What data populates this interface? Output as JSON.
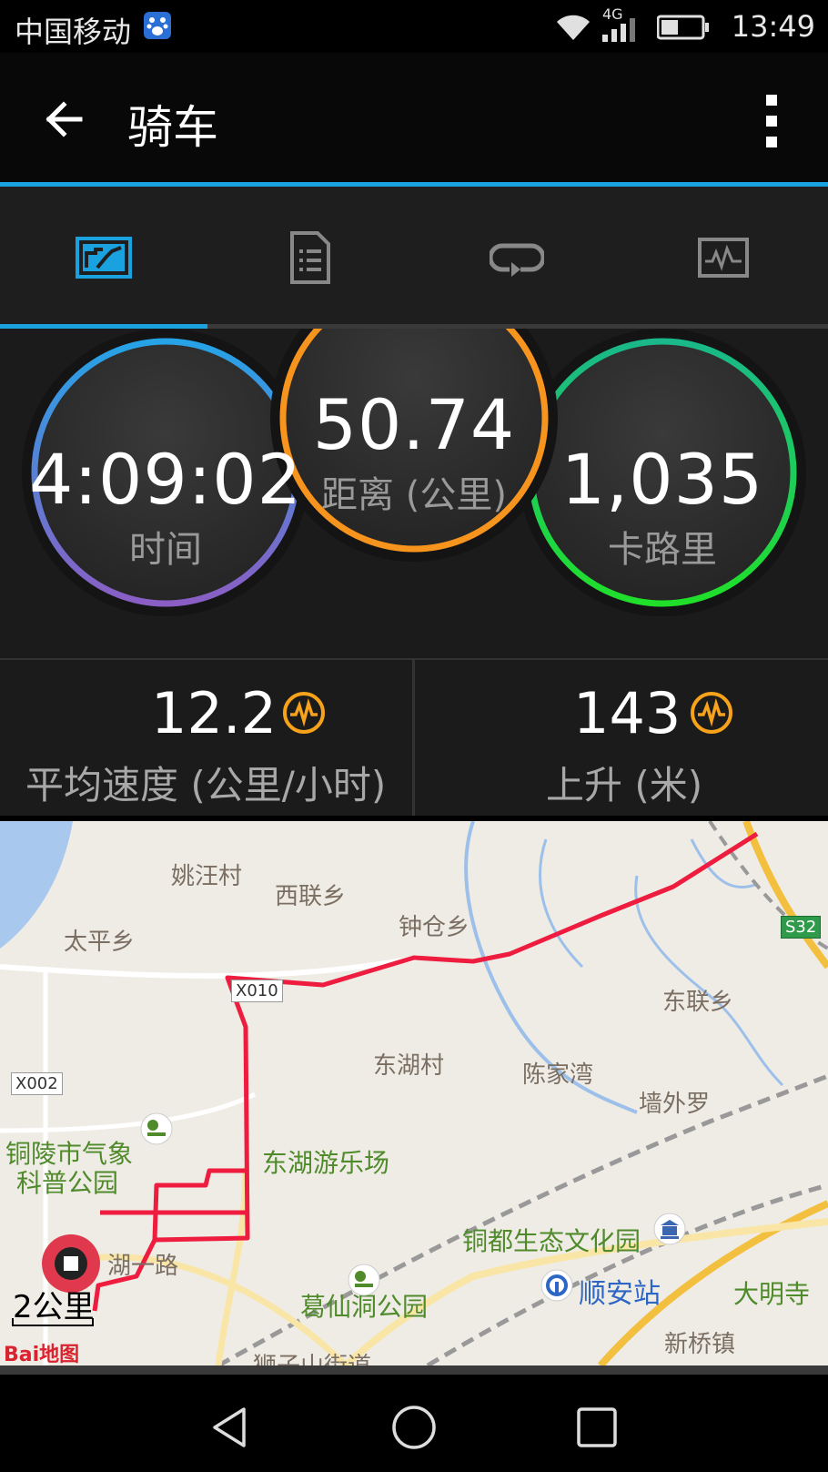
{
  "status_bar": {
    "carrier": "中国移动",
    "network": "4G",
    "time": "13:49"
  },
  "app_bar": {
    "title": "骑车",
    "back_icon": "arrow-back-icon",
    "more_icon": "more-vertical-icon"
  },
  "tabs": [
    {
      "icon": "stats-dashboard-icon",
      "active": true
    },
    {
      "icon": "document-list-icon",
      "active": false
    },
    {
      "icon": "loop-repeat-icon",
      "active": false
    },
    {
      "icon": "activity-graph-icon",
      "active": false
    }
  ],
  "gauges": {
    "time": {
      "value": "4:09:02",
      "label": "时间"
    },
    "distance": {
      "value": "50.74",
      "label": "距离 (公里)"
    },
    "calories": {
      "value": "1,035",
      "label": "卡路里"
    }
  },
  "stats": {
    "avg_speed": {
      "value": "12.2",
      "label": "平均速度 (公里/小时)",
      "icon": "pulse-chart-icon"
    },
    "ascent": {
      "value": "143",
      "label": "上升 (米)",
      "icon": "pulse-chart-icon"
    }
  },
  "map": {
    "labels": {
      "yaowang": "姚汪村",
      "xilian": "西联乡",
      "taiping": "太平乡",
      "zhongcang": "钟仓乡",
      "donglian": "东联乡",
      "donghu": "东湖村",
      "chenjiawan": "陈家湾",
      "qiangwailuo": "墙外罗",
      "qixiang_1": "铜陵市气象",
      "qixiang_2": "科普公园",
      "donghu_park": "东湖游乐场",
      "tongdu": "铜都生态文化园",
      "shunan": "顺安站",
      "daming": "大明寺",
      "xinqiao": "新桥镇",
      "gexian": "葛仙洞公园",
      "shizishan": "狮子山街道",
      "hu_road": "湖一路"
    },
    "roads": {
      "x010": "X010",
      "x002": "X002",
      "s32": "S32"
    },
    "scale": "2公里",
    "logo": "Bai地图"
  },
  "nav_bar": {
    "back": "nav-back-icon",
    "home": "nav-home-icon",
    "recents": "nav-recents-icon"
  },
  "colors": {
    "accent_blue": "#19a1e0",
    "gauge_orange": "#f7941d",
    "gauge_green": "#1ed04a",
    "route_red": "#ee1c3e",
    "stat_icon_orange": "#f6a21a"
  }
}
